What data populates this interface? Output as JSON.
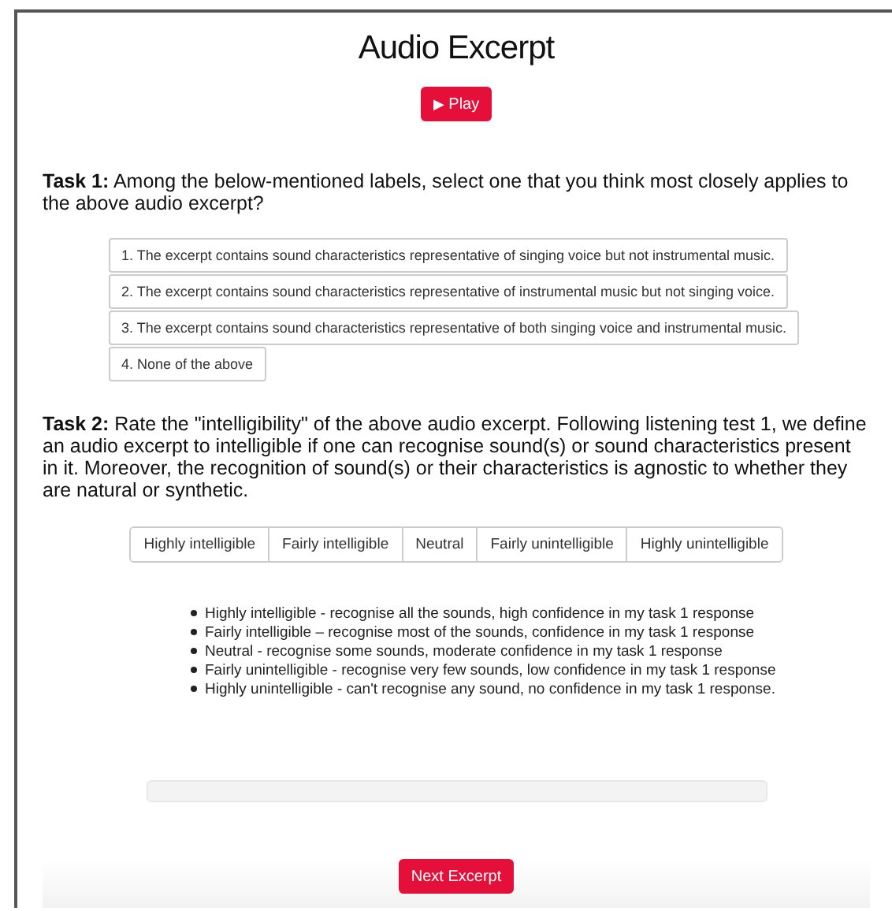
{
  "title": "Audio Excerpt",
  "play_button": {
    "icon": "▶",
    "label": "Play"
  },
  "task1": {
    "text": "**Task 1:** Among the below-mentioned labels, select one that you think most closely applies to the above audio excerpt?",
    "options": [
      {
        "label": "1. The excerpt contains sound characteristics representative of singing voice but not instrumental music.",
        "selected": false
      },
      {
        "label": "2. The excerpt contains sound characteristics representative of instrumental music but not singing voice.",
        "selected": false
      },
      {
        "label": "3. The excerpt contains sound characteristics representative of both singing voice and instrumental music.",
        "selected": false
      },
      {
        "label": "4. None of the above",
        "selected": false
      }
    ]
  },
  "task2": {
    "text": "**Task 2:** Rate the \"intelligibility\" of the above audio excerpt. Following listening test 1, we define an audio excerpt to intelligible if one can recognise sound(s) or sound characteristics present in it. Moreover, the recognition of sound(s) or their characteristics is agnostic to whether they are natural or synthetic.",
    "ratings": [
      {
        "label": "Highly intelligible",
        "selected": false
      },
      {
        "label": "Fairly intelligible",
        "selected": false
      },
      {
        "label": "Neutral",
        "selected": false
      },
      {
        "label": "Fairly unintelligible",
        "selected": false
      },
      {
        "label": "Highly unintelligible",
        "selected": false
      }
    ],
    "legend": [
      "Highly intelligible - recognise all the sounds, high confidence in my task 1 response",
      "Fairly intelligible – recognise most of the sounds, confidence in my task 1 response",
      "Neutral - recognise some sounds, moderate confidence in my task 1 response",
      "Fairly unintelligible - recognise very few sounds, low confidence in my task 1 response",
      "Highly unintelligible - can't recognise any sound, no confidence in my task 1 response."
    ]
  },
  "next_button": {
    "label": "Next Excerpt"
  }
}
